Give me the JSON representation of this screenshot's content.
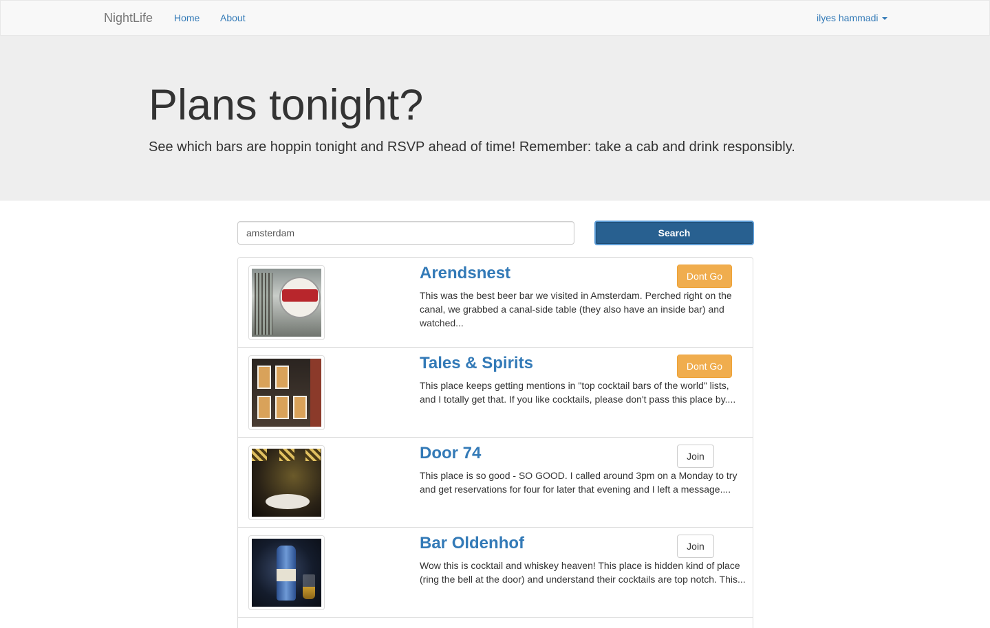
{
  "navbar": {
    "brand": "NightLife",
    "links": [
      "Home",
      "About"
    ],
    "user": "ilyes hammadi"
  },
  "jumbotron": {
    "title": "Plans tonight?",
    "subtitle": "See which bars are hoppin tonight and RSVP ahead of time! Remember: take a cab and drink responsibly."
  },
  "search": {
    "value": "amsterdam",
    "button_label": "Search"
  },
  "results": [
    {
      "name": "Arendsnest",
      "description": "This was the best beer bar we visited in Amsterdam. Perched right on the canal, we grabbed a canal-side table (they also have an inside bar) and watched...",
      "action": "Dont Go"
    },
    {
      "name": "Tales & Spirits",
      "description": "This place keeps getting mentions in \"top cocktail bars of the world\" lists, and I totally get that. If you like cocktails, please don't pass this place by....",
      "action": "Dont Go"
    },
    {
      "name": "Door 74",
      "description": "This place is so good - SO GOOD. I called around 3pm on a Monday to try and get reservations for four for later that evening and I left a message....",
      "action": "Join"
    },
    {
      "name": "Bar Oldenhof",
      "description": "Wow this is cocktail and whiskey heaven! This place is hidden kind of place (ring the bell at the door) and understand their cocktails are top notch. This...",
      "action": "Join"
    }
  ],
  "colors": {
    "link": "#337ab7",
    "primary_button": "#286090",
    "warning_button": "#f0ad4e",
    "jumbotron_bg": "#eeeeee"
  }
}
